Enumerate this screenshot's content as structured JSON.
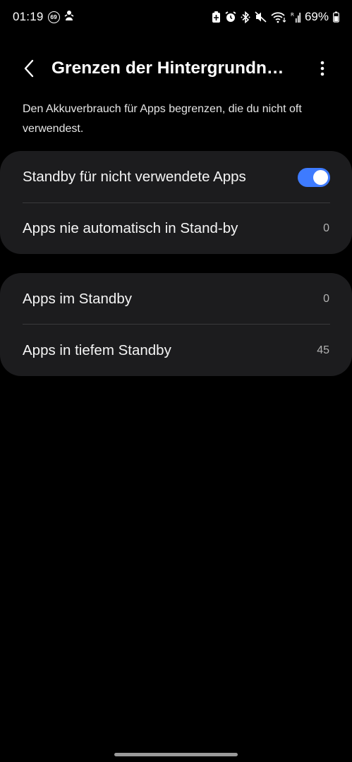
{
  "status_bar": {
    "time": "01:19",
    "badge": "69",
    "battery_percent": "69%",
    "icons": [
      "notification-badge-icon",
      "figure-icon",
      "battery-saver-icon",
      "alarm-icon",
      "bluetooth-icon",
      "mute-icon",
      "wifi-icon",
      "signal-icon",
      "battery-icon"
    ]
  },
  "app_bar": {
    "title": "Grenzen der Hintergrundn…",
    "back_icon": "back-chevron-icon",
    "more_icon": "more-vertical-icon"
  },
  "description": "Den Akkuverbrauch für Apps begrenzen, die du nicht oft verwendest.",
  "section_1": {
    "rows": [
      {
        "label": "Standby für nicht verwendete Apps",
        "toggle_on": true
      },
      {
        "label": "Apps nie automatisch in Stand-by",
        "value": "0"
      }
    ]
  },
  "section_2": {
    "rows": [
      {
        "label": "Apps im Standby",
        "value": "0"
      },
      {
        "label": "Apps in tiefem Standby",
        "value": "45"
      }
    ]
  },
  "colors": {
    "background": "#000000",
    "card": "#1c1c1e",
    "accent": "#3e7bff",
    "divider": "#3a3a3c"
  }
}
